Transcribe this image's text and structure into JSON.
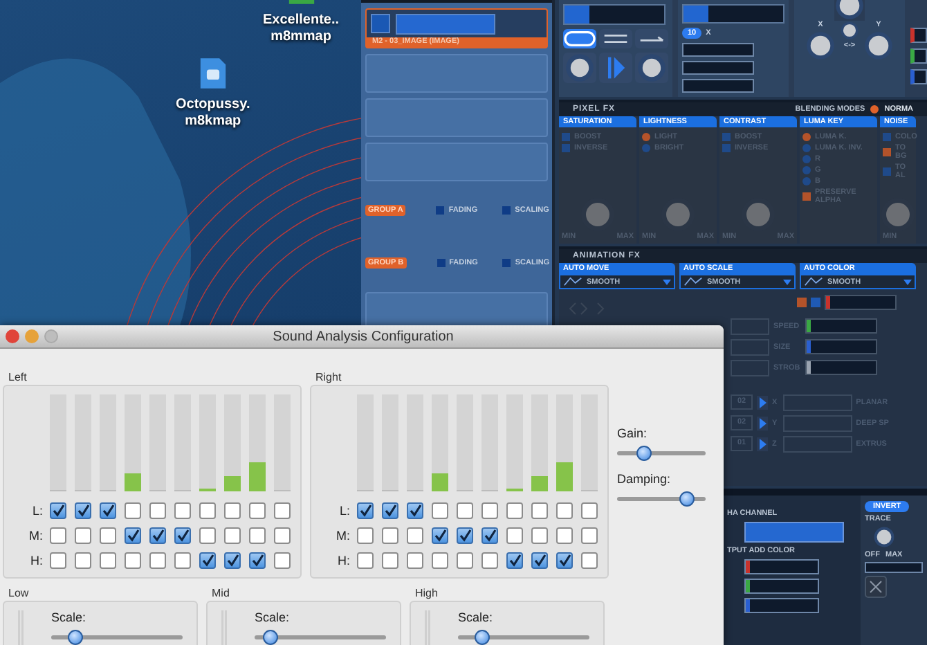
{
  "desktop": {
    "files": [
      {
        "lines": [
          "Excellente..",
          "m8mmap"
        ],
        "color": "#3aa844"
      },
      {
        "lines": [
          "Octopussy.",
          "m8kmap"
        ],
        "color": "#3d8fe0"
      }
    ]
  },
  "app": {
    "layers": [
      {
        "label": "M2 - 03_IMAGE (IMAGE)",
        "selected": true
      }
    ],
    "groups": [
      {
        "label": "GROUP A",
        "options": [
          {
            "label": "FADING",
            "checked": true
          },
          {
            "label": "SCALING",
            "checked": true
          }
        ]
      },
      {
        "label": "GROUP B",
        "options": [
          {
            "label": "FADING",
            "checked": true
          },
          {
            "label": "SCALING",
            "checked": true
          }
        ]
      }
    ],
    "transport": {
      "counter": "10",
      "counter_unit": "X",
      "knob_x": "X",
      "knob_y": "Y",
      "knob_link": "<->"
    },
    "side_meters": [
      {
        "color": "#c8322c"
      },
      {
        "color": "#3aa844"
      },
      {
        "color": "#2a5fd0"
      }
    ],
    "pixel_fx": {
      "title": "PIXEL FX",
      "blending_label": "BLENDING MODES",
      "blending_value": "NORMA",
      "blending_selected": true,
      "panels": [
        {
          "title": "SATURATION",
          "options": [
            {
              "label": "BOOST",
              "kind": "square",
              "on": false
            },
            {
              "label": "INVERSE",
              "kind": "square",
              "on": false
            }
          ],
          "knob": {
            "min": "MIN",
            "max": "MAX"
          }
        },
        {
          "title": "LIGHTNESS",
          "options": [
            {
              "label": "LIGHT",
              "kind": "round",
              "on": true
            },
            {
              "label": "BRIGHT",
              "kind": "round",
              "on": false
            }
          ],
          "knob": {
            "min": "MIN",
            "max": "MAX"
          }
        },
        {
          "title": "CONTRAST",
          "options": [
            {
              "label": "BOOST",
              "kind": "square",
              "on": false
            },
            {
              "label": "INVERSE",
              "kind": "square",
              "on": false
            }
          ],
          "knob": {
            "min": "MIN",
            "max": "MAX"
          }
        },
        {
          "title": "LUMA KEY",
          "options": [
            {
              "label": "LUMA K.",
              "kind": "round",
              "on": true
            },
            {
              "label": "LUMA K. INV.",
              "kind": "round",
              "on": false
            },
            {
              "label": "R",
              "kind": "round",
              "on": false
            },
            {
              "label": "G",
              "kind": "round",
              "on": false
            },
            {
              "label": "B",
              "kind": "round",
              "on": false
            },
            {
              "label": "PRESERVE ALPHA",
              "kind": "square",
              "on": true
            }
          ]
        },
        {
          "title": "NOISE",
          "options": [
            {
              "label": "COLO",
              "kind": "square",
              "on": false
            },
            {
              "label": "TO BG",
              "kind": "square",
              "on": true
            },
            {
              "label": "TO AL",
              "kind": "square",
              "on": false
            }
          ],
          "knob": {
            "min": "MIN"
          }
        }
      ]
    },
    "animation_fx": {
      "title": "ANIMATION FX",
      "panels": [
        {
          "title": "AUTO MOVE",
          "mode": "SMOOTH"
        },
        {
          "title": "AUTO SCALE",
          "mode": "SMOOTH"
        },
        {
          "title": "AUTO COLOR",
          "mode": "SMOOTH"
        }
      ],
      "top_meter": {
        "color": "#c8322c"
      },
      "meters": [
        {
          "label": "SPEED",
          "color": "#3aa844"
        },
        {
          "label": "SIZE",
          "color": "#2a5fd0"
        },
        {
          "label": "STROB",
          "color": "#9aa3b0"
        }
      ],
      "axes": [
        {
          "value": "02",
          "label": "X"
        },
        {
          "value": "02",
          "label": "Y"
        },
        {
          "value": "01",
          "label": "Z"
        }
      ],
      "deform": [
        "PLANAR",
        "DEEP SP",
        "EXTRUS"
      ]
    },
    "output": {
      "alpha_label": "HA CHANNEL",
      "add_color_label": "TPUT ADD COLOR",
      "add_colors": [
        {
          "color": "#c8322c"
        },
        {
          "color": "#3aa844"
        },
        {
          "color": "#2a5fd0"
        }
      ],
      "invert": "INVERT",
      "trace": "TRACE",
      "trace_min": "OFF",
      "trace_max": "MAX"
    }
  },
  "dialog": {
    "title": "Sound Analysis Configuration",
    "channels": [
      {
        "label": "Left",
        "meters": [
          {
            "level": 0
          },
          {
            "level": 0
          },
          {
            "level": 0
          },
          {
            "level": 0.18
          },
          {
            "level": 0
          },
          {
            "level": 0
          },
          {
            "level": 0.03
          },
          {
            "level": 0.16
          },
          {
            "level": 0.3
          },
          {
            "level": 0
          }
        ],
        "rows": [
          {
            "label": "L:",
            "checks": [
              true,
              true,
              true,
              false,
              false,
              false,
              false,
              false,
              false,
              false
            ]
          },
          {
            "label": "M:",
            "checks": [
              false,
              false,
              false,
              true,
              true,
              true,
              false,
              false,
              false,
              false
            ]
          },
          {
            "label": "H:",
            "checks": [
              false,
              false,
              false,
              false,
              false,
              false,
              true,
              true,
              true,
              false
            ]
          }
        ]
      },
      {
        "label": "Right",
        "meters": [
          {
            "level": 0
          },
          {
            "level": 0
          },
          {
            "level": 0
          },
          {
            "level": 0.18
          },
          {
            "level": 0
          },
          {
            "level": 0
          },
          {
            "level": 0.03
          },
          {
            "level": 0.16
          },
          {
            "level": 0.3
          },
          {
            "level": 0
          }
        ],
        "rows": [
          {
            "label": "L:",
            "checks": [
              true,
              true,
              true,
              false,
              false,
              false,
              false,
              false,
              false,
              false
            ]
          },
          {
            "label": "M:",
            "checks": [
              false,
              false,
              false,
              true,
              true,
              true,
              false,
              false,
              false,
              false
            ]
          },
          {
            "label": "H:",
            "checks": [
              false,
              false,
              false,
              false,
              false,
              false,
              true,
              true,
              true,
              false
            ]
          }
        ]
      }
    ],
    "sliders": [
      {
        "label": "Gain:",
        "level": 0.3
      },
      {
        "label": "Damping:",
        "level": 0.78
      }
    ],
    "bands": [
      {
        "label": "Low",
        "scale_label": "Scale:",
        "level": 0.18
      },
      {
        "label": "Mid",
        "scale_label": "Scale:",
        "level": 0.12
      },
      {
        "label": "High",
        "scale_label": "Scale:",
        "level": 0.18
      }
    ]
  }
}
